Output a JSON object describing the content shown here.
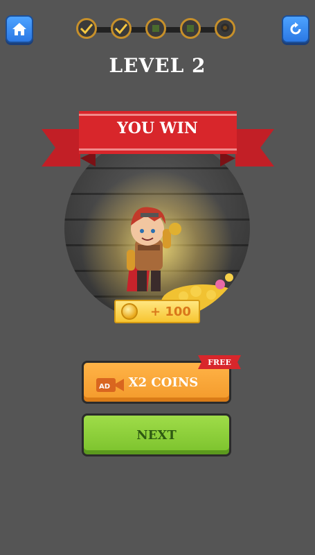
{
  "header": {
    "home_icon": "home-icon",
    "restart_icon": "restart-icon",
    "stages": [
      {
        "state": "completed"
      },
      {
        "state": "completed"
      },
      {
        "state": "locked"
      },
      {
        "state": "locked"
      },
      {
        "state": "boss"
      }
    ],
    "level_title": "LEVEL 2"
  },
  "banner": {
    "text": "YOU WIN",
    "color": "#d8262b"
  },
  "reward": {
    "amount": "+ 100",
    "icon": "coin-icon"
  },
  "buttons": {
    "x2_label": "X2 COINS",
    "ad_label": "AD",
    "free_label": "FREE",
    "next_label": "NEXT"
  },
  "colors": {
    "background": "#555555",
    "x2_button": "#f39a2b",
    "next_button": "#7bc22c"
  }
}
